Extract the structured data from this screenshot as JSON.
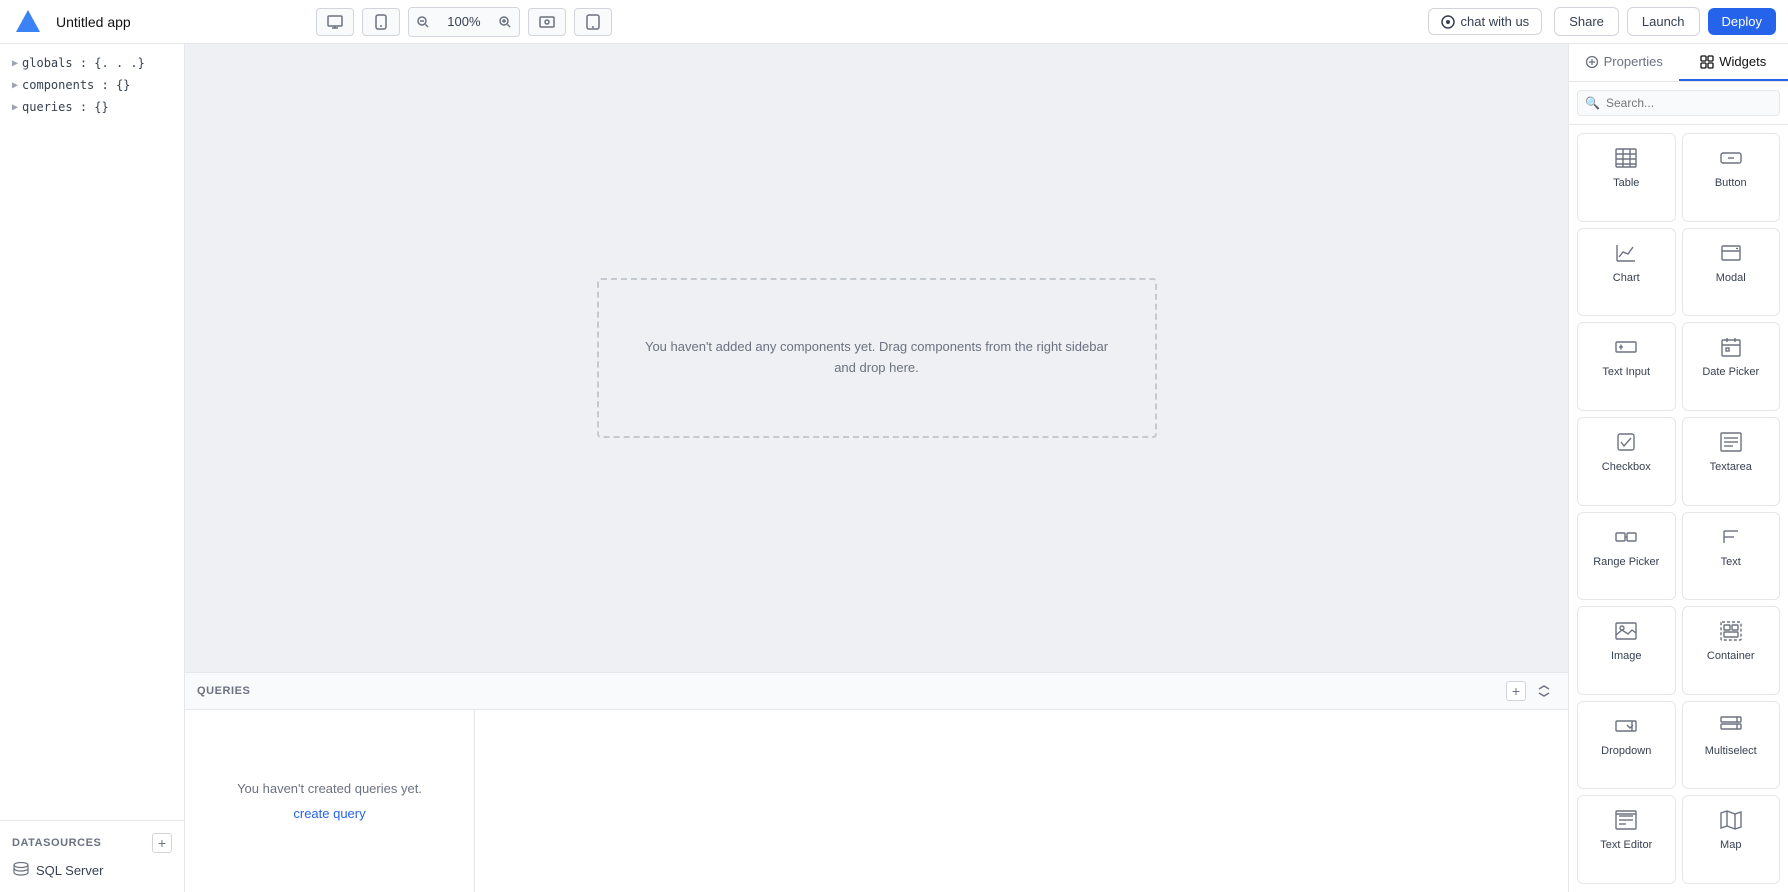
{
  "topbar": {
    "app_title": "Untitled app",
    "zoom": "100%",
    "chat_label": "chat with us",
    "share_label": "Share",
    "launch_label": "Launch",
    "deploy_label": "Deploy"
  },
  "left_sidebar": {
    "tree_items": [
      {
        "label": "globals : {. . .}"
      },
      {
        "label": "components : {}"
      },
      {
        "label": "queries : {}"
      }
    ],
    "datasources": {
      "header": "DATASOURCES",
      "items": [
        {
          "label": "SQL Server"
        }
      ]
    }
  },
  "canvas": {
    "empty_text_line1": "You haven't added any components yet. Drag components from the right sidebar",
    "empty_text_line2": "and drop here."
  },
  "queries_panel": {
    "header": "QUERIES",
    "empty_text": "You haven't created queries yet.",
    "create_link": "create query"
  },
  "right_panel": {
    "tabs": [
      {
        "id": "properties",
        "label": "Properties"
      },
      {
        "id": "widgets",
        "label": "Widgets"
      }
    ],
    "active_tab": "widgets",
    "search_placeholder": "Search...",
    "widgets": [
      {
        "id": "table",
        "label": "Table",
        "icon": "table"
      },
      {
        "id": "button",
        "label": "Button",
        "icon": "button"
      },
      {
        "id": "chart",
        "label": "Chart",
        "icon": "chart"
      },
      {
        "id": "modal",
        "label": "Modal",
        "icon": "modal"
      },
      {
        "id": "text-input",
        "label": "Text Input",
        "icon": "text-input"
      },
      {
        "id": "date-picker",
        "label": "Date Picker",
        "icon": "date-picker"
      },
      {
        "id": "checkbox",
        "label": "Checkbox",
        "icon": "checkbox"
      },
      {
        "id": "textarea",
        "label": "Textarea",
        "icon": "textarea"
      },
      {
        "id": "range-picker",
        "label": "Range Picker",
        "icon": "range-picker"
      },
      {
        "id": "text",
        "label": "Text",
        "icon": "text"
      },
      {
        "id": "image",
        "label": "Image",
        "icon": "image"
      },
      {
        "id": "container",
        "label": "Container",
        "icon": "container"
      },
      {
        "id": "dropdown",
        "label": "Dropdown",
        "icon": "dropdown"
      },
      {
        "id": "multiselect",
        "label": "Multiselect",
        "icon": "multiselect"
      },
      {
        "id": "text-editor",
        "label": "Text Editor",
        "icon": "text-editor"
      },
      {
        "id": "map",
        "label": "Map",
        "icon": "map"
      }
    ]
  }
}
